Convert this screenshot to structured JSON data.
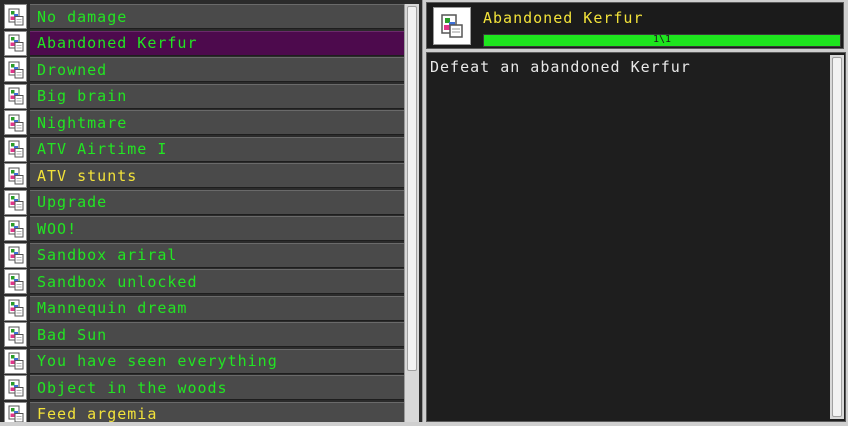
{
  "achievements": [
    {
      "label": "No damage",
      "icon": "broken-image-icon",
      "color": "#22e522",
      "selected": false
    },
    {
      "label": "Abandoned Kerfur",
      "icon": "broken-image-icon",
      "color": "#22e522",
      "selected": true
    },
    {
      "label": "Drowned",
      "icon": "broken-image-icon",
      "color": "#22e522",
      "selected": false
    },
    {
      "label": "Big brain",
      "icon": "broken-image-icon",
      "color": "#22e522",
      "selected": false
    },
    {
      "label": "Nightmare",
      "icon": "broken-image-icon",
      "color": "#22e522",
      "selected": false
    },
    {
      "label": "ATV Airtime I",
      "icon": "broken-image-icon",
      "color": "#22e522",
      "selected": false
    },
    {
      "label": "ATV stunts",
      "icon": "broken-image-icon",
      "color": "#f2e23a",
      "selected": false
    },
    {
      "label": "Upgrade",
      "icon": "broken-image-icon",
      "color": "#22e522",
      "selected": false
    },
    {
      "label": "WOO!",
      "icon": "broken-image-icon",
      "color": "#22e522",
      "selected": false
    },
    {
      "label": "Sandbox ariral",
      "icon": "broken-image-icon",
      "color": "#22e522",
      "selected": false
    },
    {
      "label": "Sandbox unlocked",
      "icon": "broken-image-icon",
      "color": "#22e522",
      "selected": false
    },
    {
      "label": "Mannequin dream",
      "icon": "broken-image-icon",
      "color": "#22e522",
      "selected": false
    },
    {
      "label": "Bad Sun",
      "icon": "broken-image-icon",
      "color": "#22e522",
      "selected": false
    },
    {
      "label": "You have seen everything",
      "icon": "broken-image-icon",
      "color": "#22e522",
      "selected": false
    },
    {
      "label": "Object in the woods",
      "icon": "broken-image-icon",
      "color": "#22e522",
      "selected": false
    },
    {
      "label": "Feed argemia",
      "icon": "broken-image-icon",
      "color": "#f2e23a",
      "selected": false
    }
  ],
  "detail": {
    "title": "Abandoned Kerfur",
    "icon": "broken-image-icon",
    "progress_text": "1\\1",
    "progress_fraction": 1.0,
    "description": "Defeat an abandoned Kerfur"
  },
  "colors": {
    "accent_green": "#22e522",
    "accent_yellow": "#f2e23a",
    "selected_bg": "#4d0a4d"
  }
}
